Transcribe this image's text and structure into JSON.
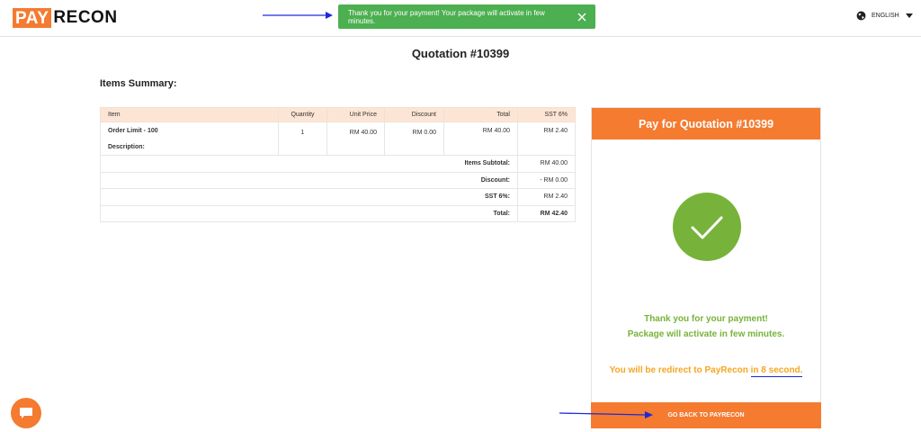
{
  "brand": {
    "pay": "PAY",
    "recon": "RECON",
    "accent": "#f47b30"
  },
  "toast": {
    "message": "Thank you for your payment! Your package will activate in few minutes.",
    "close_icon": "close-icon",
    "color": "#4caf50"
  },
  "language": {
    "label": "ENGLISH",
    "icon": "globe-icon"
  },
  "page_title": "Quotation #10399",
  "items_summary_heading": "Items Summary:",
  "table": {
    "headers": {
      "item": "Item",
      "quantity": "Quantity",
      "unit_price": "Unit Price",
      "discount": "Discount",
      "total": "Total",
      "sst": "SST 6%"
    },
    "rows": [
      {
        "item": "Order Limit - 100",
        "description_label": "Description:",
        "quantity": "1",
        "unit_price": "RM 40.00",
        "discount": "RM 0.00",
        "total": "RM 40.00",
        "sst": "RM 2.40"
      }
    ],
    "summary": {
      "subtotal_label": "Items Subtotal:",
      "subtotal_value": "RM 40.00",
      "discount_label": "Discount:",
      "discount_value": "- RM 0.00",
      "sst_label": "SST 6%:",
      "sst_value": "RM 2.40",
      "total_label": "Total:",
      "total_value": "RM 42.40"
    }
  },
  "pay_card": {
    "title": "Pay for Quotation #10399",
    "success_color": "#77b33a",
    "thanks_line1": "Thank you for your payment!",
    "thanks_line2": "Package will activate in few minutes.",
    "redirect_prefix": "You will be redirect to PayRecon ",
    "redirect_count": "in 8 second.",
    "redirect_color": "#f5a623",
    "back_button": "GO BACK TO PAYRECON"
  },
  "chat": {
    "icon": "chat-icon"
  }
}
